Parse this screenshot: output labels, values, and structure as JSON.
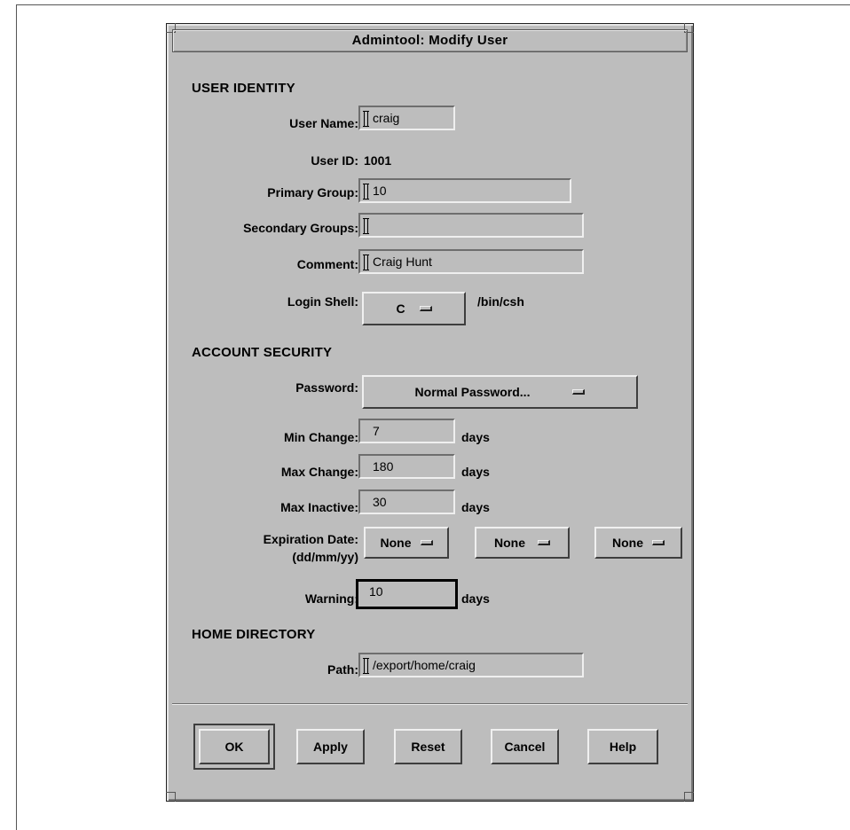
{
  "window": {
    "title": "Admintool: Modify User"
  },
  "sections": {
    "user_identity": "USER IDENTITY",
    "account_security": "ACCOUNT SECURITY",
    "home_directory": "HOME DIRECTORY"
  },
  "user_identity": {
    "user_name_label": "User Name:",
    "user_name_value": "craig",
    "user_id_label": "User ID:",
    "user_id_value": "1001",
    "primary_group_label": "Primary Group:",
    "primary_group_value": "10",
    "secondary_groups_label": "Secondary Groups:",
    "secondary_groups_value": "",
    "comment_label": "Comment:",
    "comment_value": "Craig Hunt",
    "login_shell_label": "Login Shell:",
    "login_shell_value": "C",
    "login_shell_path": "/bin/csh"
  },
  "account_security": {
    "password_label": "Password:",
    "password_value": "Normal Password...",
    "min_change_label": "Min Change:",
    "min_change_value": "7",
    "max_change_label": "Max Change:",
    "max_change_value": "180",
    "max_inactive_label": "Max Inactive:",
    "max_inactive_value": "30",
    "days_label": "days",
    "expiration_label_line1": "Expiration Date:",
    "expiration_label_line2": "(dd/mm/yy)",
    "expiration_day": "None",
    "expiration_month": "None",
    "expiration_year": "None",
    "warning_label": "Warning:",
    "warning_value": "10"
  },
  "home_directory": {
    "path_label": "Path:",
    "path_value": "/export/home/craig"
  },
  "buttons": {
    "ok": "OK",
    "apply": "Apply",
    "reset": "Reset",
    "cancel": "Cancel",
    "help": "Help"
  }
}
